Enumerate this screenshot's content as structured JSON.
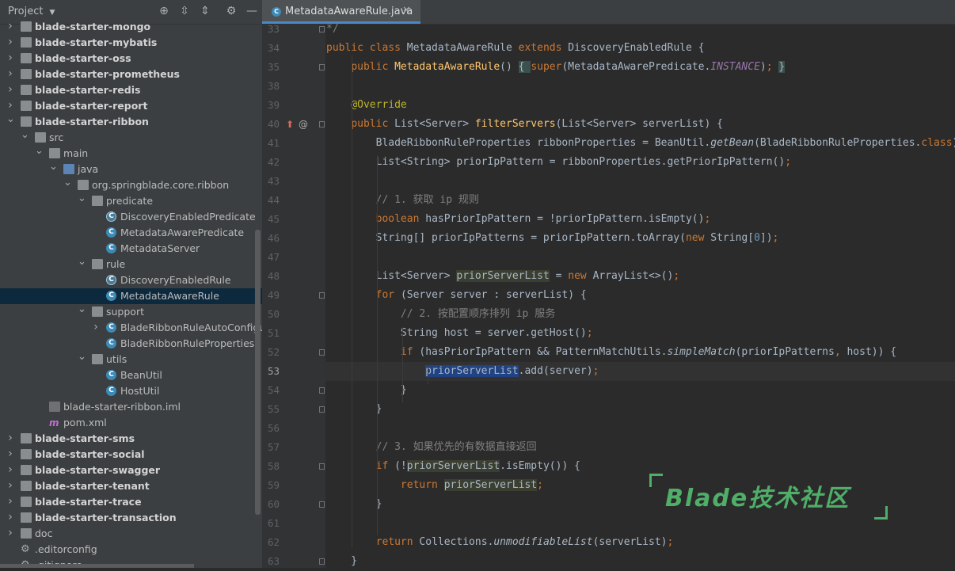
{
  "project_panel": {
    "title": "Project",
    "tree": [
      {
        "label": "blade-starter-mongo",
        "kind": "module",
        "depth": 0,
        "expanded": false
      },
      {
        "label": "blade-starter-mybatis",
        "kind": "module",
        "depth": 0,
        "expanded": false
      },
      {
        "label": "blade-starter-oss",
        "kind": "module",
        "depth": 0,
        "expanded": false
      },
      {
        "label": "blade-starter-prometheus",
        "kind": "module",
        "depth": 0,
        "expanded": false
      },
      {
        "label": "blade-starter-redis",
        "kind": "module",
        "depth": 0,
        "expanded": false
      },
      {
        "label": "blade-starter-report",
        "kind": "module",
        "depth": 0,
        "expanded": false
      },
      {
        "label": "blade-starter-ribbon",
        "kind": "module",
        "depth": 0,
        "expanded": true
      },
      {
        "label": "src",
        "kind": "folder",
        "depth": 1,
        "expanded": true
      },
      {
        "label": "main",
        "kind": "folder",
        "depth": 2,
        "expanded": true
      },
      {
        "label": "java",
        "kind": "folder-blue",
        "depth": 3,
        "expanded": true
      },
      {
        "label": "org.springblade.core.ribbon",
        "kind": "package",
        "depth": 4,
        "expanded": true
      },
      {
        "label": "predicate",
        "kind": "package",
        "depth": 5,
        "expanded": true
      },
      {
        "label": "DiscoveryEnabledPredicate",
        "kind": "abstract-class",
        "depth": 6
      },
      {
        "label": "MetadataAwarePredicate",
        "kind": "class",
        "depth": 6
      },
      {
        "label": "MetadataServer",
        "kind": "class",
        "depth": 6
      },
      {
        "label": "rule",
        "kind": "package",
        "depth": 5,
        "expanded": true
      },
      {
        "label": "DiscoveryEnabledRule",
        "kind": "abstract-class",
        "depth": 6
      },
      {
        "label": "MetadataAwareRule",
        "kind": "class",
        "depth": 6,
        "selected": true
      },
      {
        "label": "support",
        "kind": "package",
        "depth": 5,
        "expanded": true
      },
      {
        "label": "BladeRibbonRuleAutoConfigura",
        "kind": "class",
        "depth": 6,
        "expandable": true
      },
      {
        "label": "BladeRibbonRuleProperties",
        "kind": "class",
        "depth": 6
      },
      {
        "label": "utils",
        "kind": "package",
        "depth": 5,
        "expanded": true
      },
      {
        "label": "BeanUtil",
        "kind": "class",
        "depth": 6
      },
      {
        "label": "HostUtil",
        "kind": "class",
        "depth": 6
      },
      {
        "label": "blade-starter-ribbon.iml",
        "kind": "iml",
        "depth": 2
      },
      {
        "label": "pom.xml",
        "kind": "maven",
        "depth": 2
      },
      {
        "label": "blade-starter-sms",
        "kind": "module",
        "depth": 0,
        "expanded": false
      },
      {
        "label": "blade-starter-social",
        "kind": "module",
        "depth": 0,
        "expanded": false
      },
      {
        "label": "blade-starter-swagger",
        "kind": "module",
        "depth": 0,
        "expanded": false
      },
      {
        "label": "blade-starter-tenant",
        "kind": "module",
        "depth": 0,
        "expanded": false
      },
      {
        "label": "blade-starter-trace",
        "kind": "module",
        "depth": 0,
        "expanded": false
      },
      {
        "label": "blade-starter-transaction",
        "kind": "module",
        "depth": 0,
        "expanded": false
      },
      {
        "label": "doc",
        "kind": "folder",
        "depth": 0,
        "expanded": false
      },
      {
        "label": ".editorconfig",
        "kind": "config",
        "depth": 0
      },
      {
        "label": ".gitignore",
        "kind": "config",
        "depth": 0
      }
    ]
  },
  "editor": {
    "tab_title": "MetadataAwareRule.java",
    "current_line": "53",
    "lines": [
      {
        "n": "33",
        "segs": [
          {
            "t": "*/",
            "c": "cm"
          }
        ]
      },
      {
        "n": "34",
        "segs": [
          {
            "t": "public class ",
            "c": "kw"
          },
          {
            "t": "MetadataAwareRule "
          },
          {
            "t": "extends ",
            "c": "kw"
          },
          {
            "t": "DiscoveryEnabledRule {"
          }
        ]
      },
      {
        "n": "35",
        "segs": [
          {
            "t": "    "
          },
          {
            "t": "public ",
            "c": "kw"
          },
          {
            "t": "MetadataAwareRule",
            "c": "fn"
          },
          {
            "t": "() "
          },
          {
            "t": "{ ",
            "c": "hl-brace"
          },
          {
            "t": "super",
            "c": "kw"
          },
          {
            "t": "(MetadataAwarePredicate."
          },
          {
            "t": "INSTANCE",
            "c": "cn"
          },
          {
            "t": ")"
          },
          {
            "t": "; ",
            "c": "kw"
          },
          {
            "t": "}",
            "c": "hl-brace"
          }
        ]
      },
      {
        "n": "38",
        "segs": []
      },
      {
        "n": "39",
        "segs": [
          {
            "t": "    "
          },
          {
            "t": "@Override",
            "c": "an"
          }
        ]
      },
      {
        "n": "40",
        "segs": [
          {
            "t": "    "
          },
          {
            "t": "public ",
            "c": "kw"
          },
          {
            "t": "List<Server> "
          },
          {
            "t": "filterServers",
            "c": "fn"
          },
          {
            "t": "(List<Server> serverList) {"
          }
        ]
      },
      {
        "n": "41",
        "segs": [
          {
            "t": "        BladeRibbonRuleProperties ribbonProperties = BeanUtil."
          },
          {
            "t": "getBean",
            "c": "it"
          },
          {
            "t": "(BladeRibbonRuleProperties."
          },
          {
            "t": "class",
            "c": "kw"
          },
          {
            "t": ");"
          }
        ]
      },
      {
        "n": "42",
        "segs": [
          {
            "t": "        List<String> priorIpPattern = ribbonProperties.getPriorIpPattern()"
          },
          {
            "t": ";",
            "c": "kw"
          }
        ]
      },
      {
        "n": "43",
        "segs": []
      },
      {
        "n": "44",
        "segs": [
          {
            "t": "        "
          },
          {
            "t": "// 1. 获取 ip 规则",
            "c": "cm"
          }
        ]
      },
      {
        "n": "45",
        "segs": [
          {
            "t": "        "
          },
          {
            "t": "boolean ",
            "c": "kw"
          },
          {
            "t": "hasPriorIpPattern = !priorIpPattern.isEmpty()"
          },
          {
            "t": ";",
            "c": "kw"
          }
        ]
      },
      {
        "n": "46",
        "segs": [
          {
            "t": "        String[] priorIpPatterns = priorIpPattern.toArray("
          },
          {
            "t": "new ",
            "c": "kw"
          },
          {
            "t": "String["
          },
          {
            "t": "0",
            "c": "num"
          },
          {
            "t": "])"
          },
          {
            "t": ";",
            "c": "kw"
          }
        ]
      },
      {
        "n": "47",
        "segs": []
      },
      {
        "n": "48",
        "segs": [
          {
            "t": "        List<Server> "
          },
          {
            "t": "priorServerList",
            "c": "hl-read"
          },
          {
            "t": " = "
          },
          {
            "t": "new ",
            "c": "kw"
          },
          {
            "t": "ArrayList<>()"
          },
          {
            "t": ";",
            "c": "kw"
          }
        ]
      },
      {
        "n": "49",
        "segs": [
          {
            "t": "        "
          },
          {
            "t": "for ",
            "c": "kw"
          },
          {
            "t": "(Server server : serverList) {"
          }
        ]
      },
      {
        "n": "50",
        "segs": [
          {
            "t": "            "
          },
          {
            "t": "// 2. 按配置顺序排列 ip 服务",
            "c": "cm"
          }
        ]
      },
      {
        "n": "51",
        "segs": [
          {
            "t": "            String host = server.getHost()"
          },
          {
            "t": ";",
            "c": "kw"
          }
        ]
      },
      {
        "n": "52",
        "segs": [
          {
            "t": "            "
          },
          {
            "t": "if ",
            "c": "kw"
          },
          {
            "t": "(hasPriorIpPattern && PatternMatchUtils."
          },
          {
            "t": "simpleMatch",
            "c": "it"
          },
          {
            "t": "(priorIpPatterns"
          },
          {
            "t": ", ",
            "c": "kw"
          },
          {
            "t": "host)) {"
          }
        ]
      },
      {
        "n": "53",
        "segs": [
          {
            "t": "                "
          },
          {
            "t": "priorServerList",
            "c": "hl-sel"
          },
          {
            "t": ".add(server)"
          },
          {
            "t": ";",
            "c": "kw"
          }
        ]
      },
      {
        "n": "54",
        "segs": [
          {
            "t": "            }"
          }
        ]
      },
      {
        "n": "55",
        "segs": [
          {
            "t": "        }"
          }
        ]
      },
      {
        "n": "56",
        "segs": []
      },
      {
        "n": "57",
        "segs": [
          {
            "t": "        "
          },
          {
            "t": "// 3. 如果优先的有数据直接返回",
            "c": "cm"
          }
        ]
      },
      {
        "n": "58",
        "segs": [
          {
            "t": "        "
          },
          {
            "t": "if ",
            "c": "kw"
          },
          {
            "t": "(!"
          },
          {
            "t": "priorServerList",
            "c": "hl-read"
          },
          {
            "t": ".isEmpty()) {"
          }
        ]
      },
      {
        "n": "59",
        "segs": [
          {
            "t": "            "
          },
          {
            "t": "return ",
            "c": "kw"
          },
          {
            "t": "priorServerList",
            "c": "hl-read"
          },
          {
            "t": ";",
            "c": "kw"
          }
        ]
      },
      {
        "n": "60",
        "segs": [
          {
            "t": "        }"
          }
        ]
      },
      {
        "n": "61",
        "segs": []
      },
      {
        "n": "62",
        "segs": [
          {
            "t": "        "
          },
          {
            "t": "return ",
            "c": "kw"
          },
          {
            "t": "Collections."
          },
          {
            "t": "unmodifiableList",
            "c": "it"
          },
          {
            "t": "(serverList)"
          },
          {
            "t": ";",
            "c": "kw"
          }
        ]
      },
      {
        "n": "63",
        "segs": [
          {
            "t": "    }"
          }
        ]
      }
    ]
  },
  "watermark": {
    "text": "Blade技术社区"
  },
  "colors": {
    "background": "#2b2b2b",
    "panel": "#3c3f41",
    "gutter": "#313335",
    "keyword": "#cc7832",
    "method": "#ffc66d",
    "comment": "#808080",
    "annotation": "#bbb529",
    "selection": "#214283",
    "watermark": "#4fae68"
  },
  "icons": {
    "header": [
      "target-icon",
      "expand-all-icon",
      "collapse-all-icon",
      "gear-icon",
      "minimize-icon"
    ],
    "gutter_line_40": [
      "override-up-arrow-icon",
      "at-annotation-icon"
    ]
  }
}
